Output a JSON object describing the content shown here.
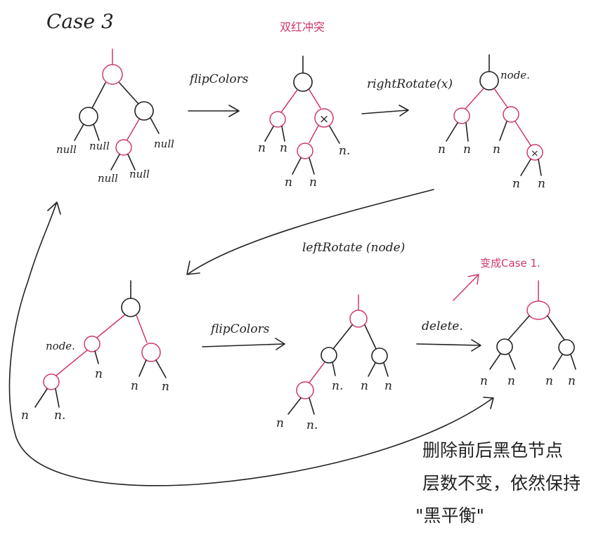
{
  "title": "Case 3",
  "labels": {
    "double_red": "双红冲突",
    "flip1": "flipColors",
    "rotate_right": "rightRotate(x)",
    "rotate_left": "leftRotate (node)",
    "flip2": "flipColors",
    "delete": "delete.",
    "becomes_case1": "变成Case 1.",
    "note_line1": "删除前后黑色节点",
    "note_line2": "层数不变，依然保持",
    "note_line3": "\"黑平衡\"",
    "node_tag_top": "node.",
    "node_tag_bottom": "node.",
    "null": "null",
    "n": "n",
    "n_dot": "n.",
    "x": "×"
  },
  "colors": {
    "ink": "#222222",
    "red": "#d0386a"
  }
}
